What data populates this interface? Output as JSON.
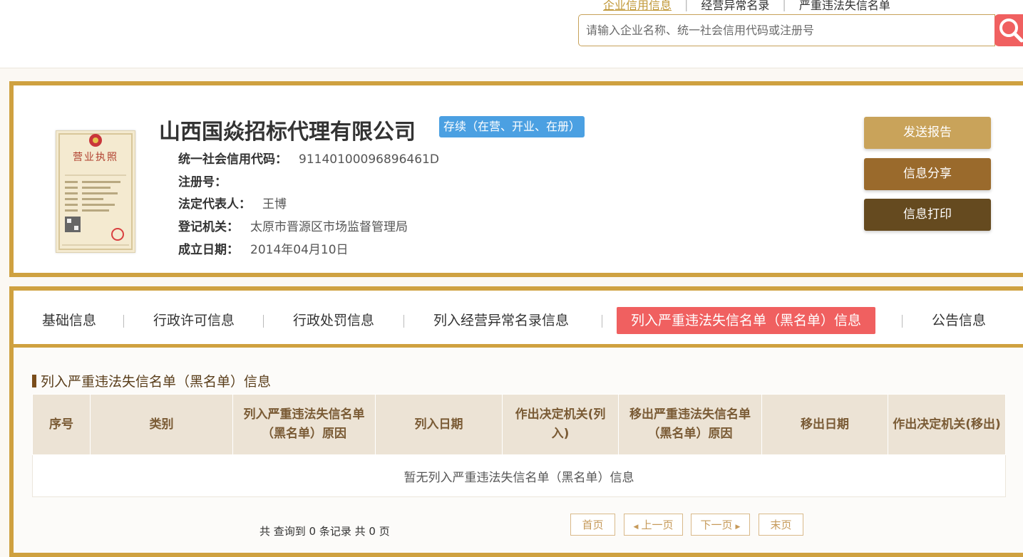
{
  "header": {
    "links": [
      "企业信用信息",
      "经营异常名录",
      "严重违法失信名单"
    ],
    "search_placeholder": "请输入企业名称、统一社会信用代码或注册号"
  },
  "company": {
    "name": "山西国焱招标代理有限公司",
    "status": "存续（在营、开业、在册）",
    "credit_code_label": "统一社会信用代码：",
    "credit_code": "91140100096896461D",
    "reg_no_label": "注册号：",
    "reg_no": "",
    "legal_rep_label": "法定代表人：",
    "legal_rep": "王博",
    "authority_label": "登记机关：",
    "authority": "太原市晋源区市场监督管理局",
    "founded_label": "成立日期：",
    "founded": "2014年04月10日",
    "license_title": "营业执照"
  },
  "actions": [
    "发送报告",
    "信息分享",
    "信息打印"
  ],
  "tabs": [
    "基础信息",
    "行政许可信息",
    "行政处罚信息",
    "列入经营异常名录信息",
    "列入严重违法失信名单（黑名单）信息",
    "公告信息"
  ],
  "active_tab_index": 4,
  "section": {
    "title": "列入严重违法失信名单（黑名单）信息",
    "columns": [
      "序号",
      "类别",
      "列入严重违法失信名单（黑名单）原因",
      "列入日期",
      "作出决定机关(列入)",
      "移出严重违法失信名单（黑名单）原因",
      "移出日期",
      "作出决定机关(移出)"
    ],
    "empty_text": "暂无列入严重违法失信名单（黑名单）信息"
  },
  "pagination": {
    "summary": "共 查询到 0 条记录 共 0 页",
    "first": "首页",
    "prev": "上一页",
    "next": "下一页",
    "last": "末页"
  },
  "colors": {
    "gold_border": "#cfa140",
    "active_tab": "#f06060",
    "status_badge": "#4ba0e2",
    "btn_send": "#c9a35a",
    "btn_share": "#9a6a2c",
    "btn_print": "#654a1f"
  }
}
